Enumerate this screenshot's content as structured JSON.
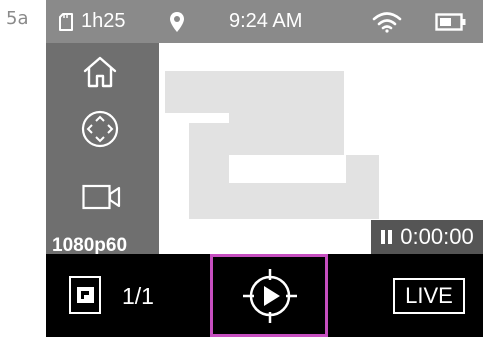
{
  "figure": {
    "step_label": "5a"
  },
  "status_bar": {
    "time_remaining": "1h25",
    "clock": "9:24 AM"
  },
  "sidebar": {
    "resolution": "1080p60"
  },
  "preview": {
    "recording_time": "0:00:00"
  },
  "bottom_bar": {
    "media_counter": "1/1",
    "live_label": "LIVE",
    "highlight_color": "#c64fc0"
  }
}
